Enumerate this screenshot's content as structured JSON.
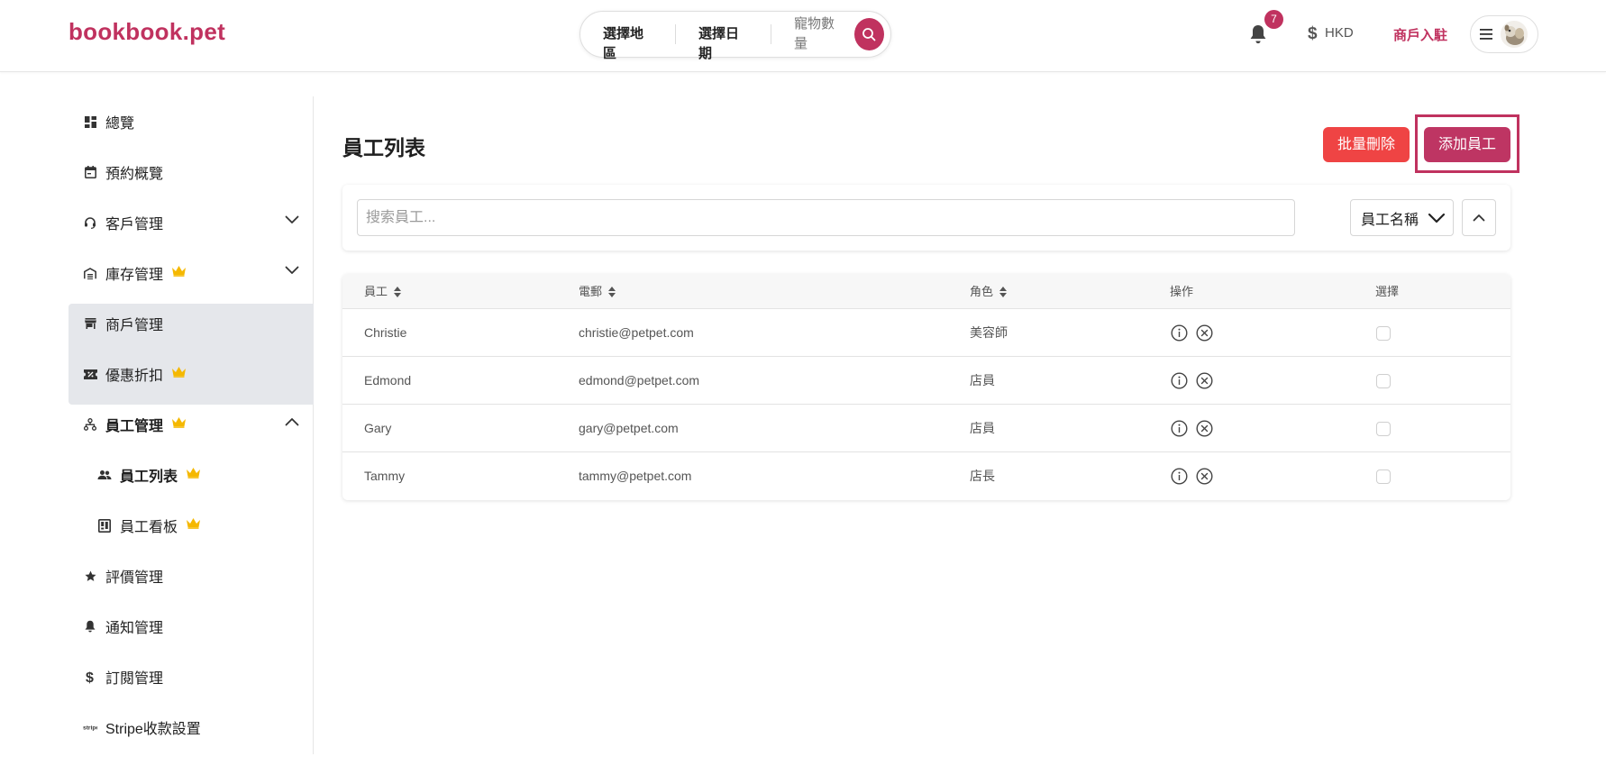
{
  "header": {
    "logo": "bookbook.pet",
    "search": {
      "region": "選擇地區",
      "date": "選擇日期",
      "pets": "寵物數量"
    },
    "notification_count": "7",
    "currency": "HKD",
    "merchant_link": "商戶入駐"
  },
  "sidebar": {
    "items": [
      {
        "label": "總覽",
        "icon": "dashboard-icon"
      },
      {
        "label": "預約概覽",
        "icon": "calendar-icon"
      },
      {
        "label": "客戶管理",
        "icon": "headset-icon"
      },
      {
        "label": "庫存管理",
        "icon": "warehouse-icon"
      },
      {
        "label": "商戶管理",
        "icon": "store-icon"
      },
      {
        "label": "優惠折扣",
        "icon": "ticket-icon"
      },
      {
        "label": "員工管理",
        "icon": "org-chart-icon"
      },
      {
        "label": "員工列表",
        "icon": "people-icon"
      },
      {
        "label": "員工看板",
        "icon": "board-icon"
      },
      {
        "label": "評價管理",
        "icon": "star-icon"
      },
      {
        "label": "通知管理",
        "icon": "bell-icon"
      },
      {
        "label": "訂閱管理",
        "icon": "dollar-icon"
      },
      {
        "label": "Stripe收款設置",
        "icon": "stripe-icon"
      }
    ]
  },
  "main": {
    "title": "員工列表",
    "bulk_delete": "批量刪除",
    "add_staff": "添加員工",
    "search_placeholder": "搜索員工...",
    "sort_field": "員工名稱",
    "columns": {
      "name": "員工",
      "email": "電郵",
      "role": "角色",
      "actions": "操作",
      "select": "選擇"
    },
    "rows": [
      {
        "name": "Christie",
        "email": "christie@petpet.com",
        "role": "美容師"
      },
      {
        "name": "Edmond",
        "email": "edmond@petpet.com",
        "role": "店員"
      },
      {
        "name": "Gary",
        "email": "gary@petpet.com",
        "role": "店員"
      },
      {
        "name": "Tammy",
        "email": "tammy@petpet.com",
        "role": "店長"
      }
    ]
  },
  "colors": {
    "brand": "#c0325f",
    "danger": "#ef4444",
    "crown": "#f5b800",
    "active_bg": "#e5e7eb"
  }
}
